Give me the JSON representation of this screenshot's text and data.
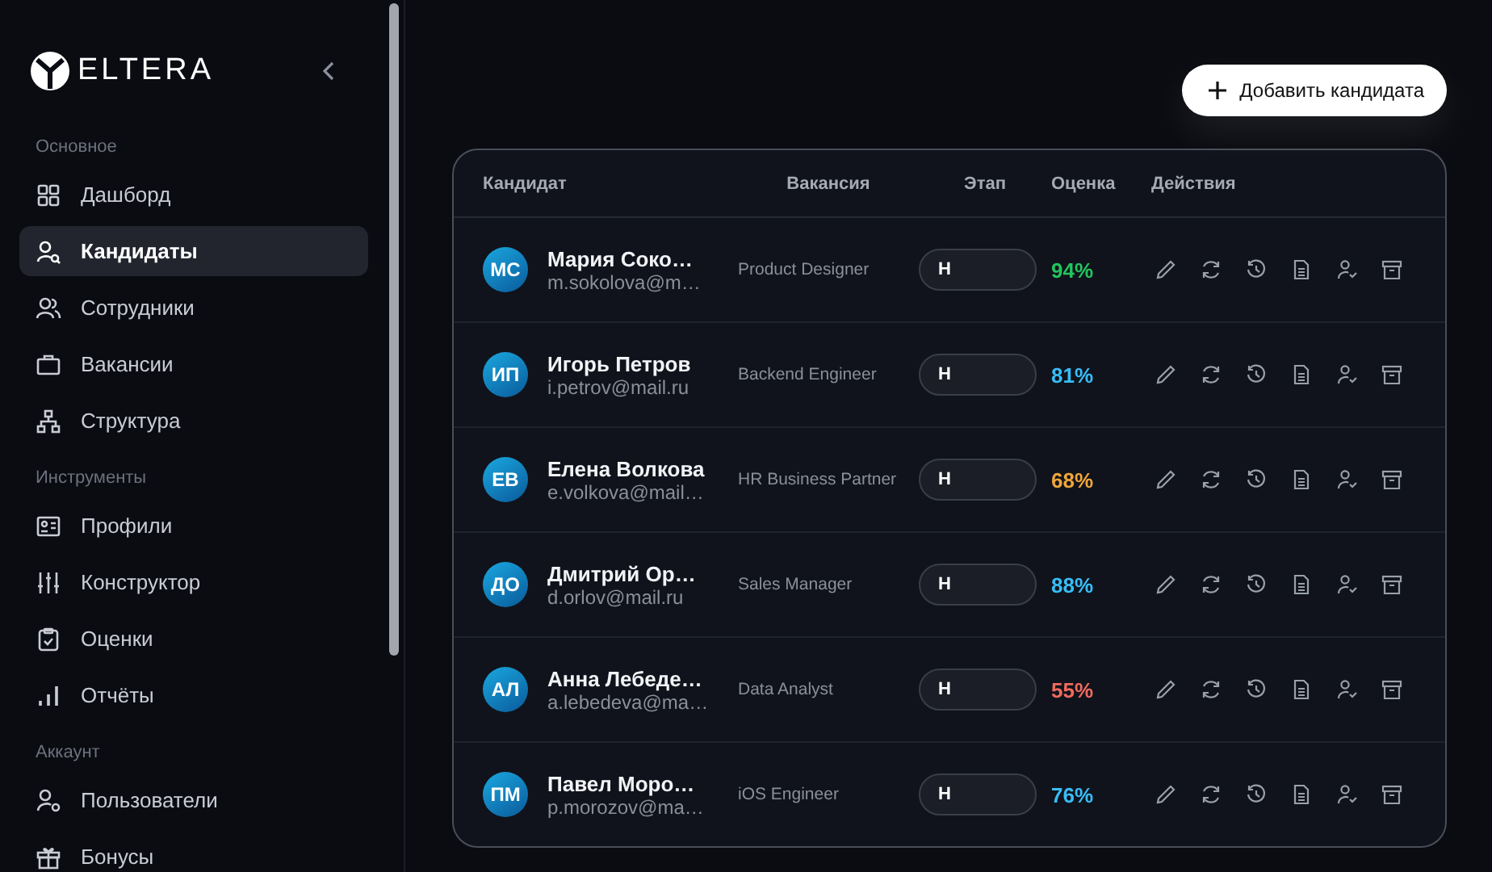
{
  "sidebar": {
    "logo": "ELTERA",
    "sections": [
      {
        "label": "Основное",
        "items": [
          {
            "label": "Дашборд",
            "selected": false
          },
          {
            "label": "Кандидаты",
            "selected": true
          },
          {
            "label": "Сотрудники",
            "selected": false
          },
          {
            "label": "Вакансии",
            "selected": false
          },
          {
            "label": "Структура",
            "selected": false
          }
        ]
      },
      {
        "label": "Инструменты",
        "items": [
          {
            "label": "Профили",
            "selected": false
          },
          {
            "label": "Конструктор",
            "selected": false
          },
          {
            "label": "Оценки",
            "selected": false
          },
          {
            "label": "Отчёты",
            "selected": false
          }
        ]
      },
      {
        "label": "Аккаунт",
        "items": [
          {
            "label": "Пользователи",
            "selected": false
          },
          {
            "label": "Бонусы",
            "selected": false
          }
        ]
      }
    ]
  },
  "add_button": "Добавить кандидата",
  "table": {
    "columns": [
      "Кандидат",
      "Вакансия",
      "Этап",
      "Оценка",
      "Действия"
    ],
    "rows": [
      {
        "initials": "МС",
        "name": "Мария Соко…",
        "email": "m.sokolova@m…",
        "vacancy": "Product Designer",
        "stage": "Н",
        "score": "94%",
        "color": "#22c55e"
      },
      {
        "initials": "ИП",
        "name": "Игорь Петров",
        "email": "i.petrov@mail.ru",
        "vacancy": "Backend Engineer",
        "stage": "Н",
        "score": "81%",
        "color": "#38bdf8"
      },
      {
        "initials": "ЕВ",
        "name": "Елена Волкова",
        "email": "e.volkova@mail…",
        "vacancy": "HR Business Partner",
        "stage": "Н",
        "score": "68%",
        "color": "#f0a53a"
      },
      {
        "initials": "ДО",
        "name": "Дмитрий Ор…",
        "email": "d.orlov@mail.ru",
        "vacancy": "Sales Manager",
        "stage": "Н",
        "score": "88%",
        "color": "#38bdf8"
      },
      {
        "initials": "АЛ",
        "name": "Анна Лебеде…",
        "email": "a.lebedeva@ma…",
        "vacancy": "Data Analyst",
        "stage": "Н",
        "score": "55%",
        "color": "#ef6a5e"
      },
      {
        "initials": "ПМ",
        "name": "Павел Моро…",
        "email": "p.morozov@ma…",
        "vacancy": "iOS Engineer",
        "stage": "Н",
        "score": "76%",
        "color": "#38bdf8"
      }
    ]
  }
}
